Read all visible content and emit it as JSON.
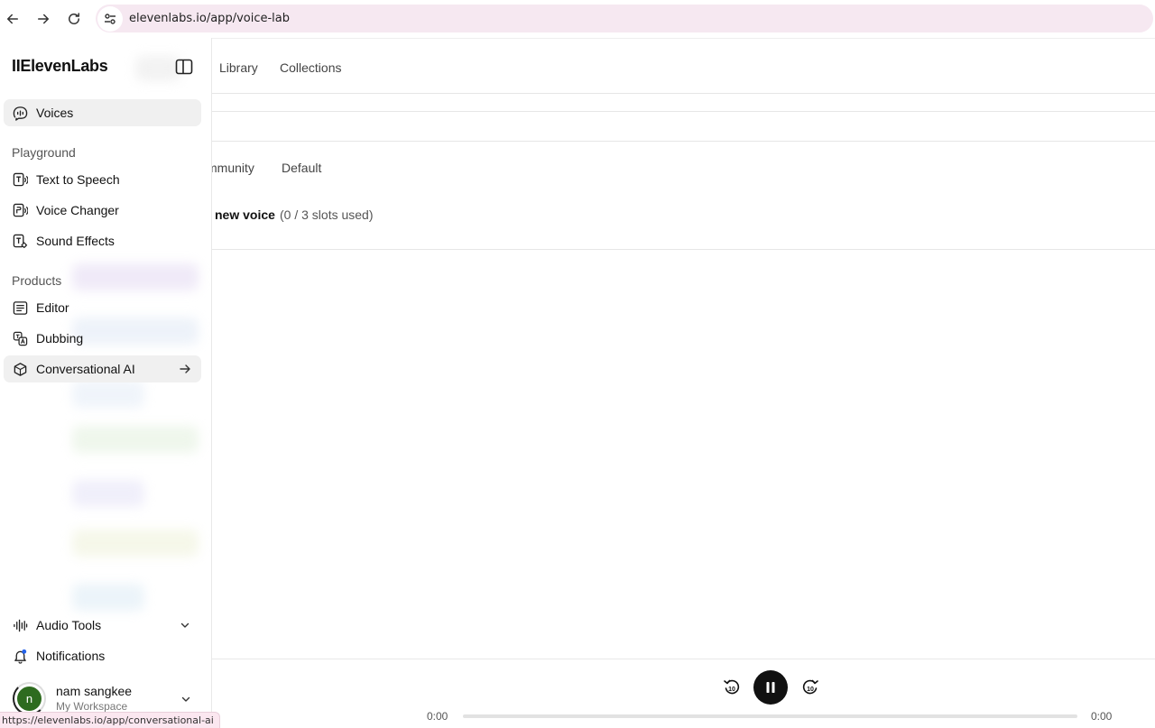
{
  "browser": {
    "url": "elevenlabs.io/app/voice-lab",
    "status_url": "https://elevenlabs.io/app/conversational-ai"
  },
  "sidebar": {
    "logo": "IIElevenLabs",
    "primary": {
      "label": "Voices",
      "icon": "voice-icon"
    },
    "playground_label": "Playground",
    "playground": [
      {
        "label": "Text to Speech",
        "icon": "text-to-speech-icon"
      },
      {
        "label": "Voice Changer",
        "icon": "voice-changer-icon"
      },
      {
        "label": "Sound Effects",
        "icon": "sound-effects-icon"
      }
    ],
    "products_label": "Products",
    "products": [
      {
        "label": "Editor",
        "icon": "editor-icon"
      },
      {
        "label": "Dubbing",
        "icon": "dubbing-icon"
      },
      {
        "label": "Conversational AI",
        "icon": "conversational-ai-icon"
      }
    ],
    "audio_tools": "Audio Tools",
    "notifications": "Notifications",
    "user": {
      "initial": "n",
      "name": "nam sangkee",
      "workspace": "My Workspace"
    }
  },
  "main": {
    "top_tabs": [
      "Library",
      "Collections"
    ],
    "sub_tabs": [
      "mmunity",
      "Default"
    ],
    "add_voice": "new voice",
    "slots": "(0 / 3 slots used)"
  },
  "player": {
    "current_time": "0:00",
    "duration": "0:00",
    "skip_back_label": "10",
    "skip_fwd_label": "10",
    "progress": 0
  },
  "colors": {
    "omnibox_bg": "#f6e8f1",
    "active_item_bg": "#f0f0f0",
    "avatar_bg": "#2e6b1f",
    "notification_dot": "#2563eb"
  }
}
